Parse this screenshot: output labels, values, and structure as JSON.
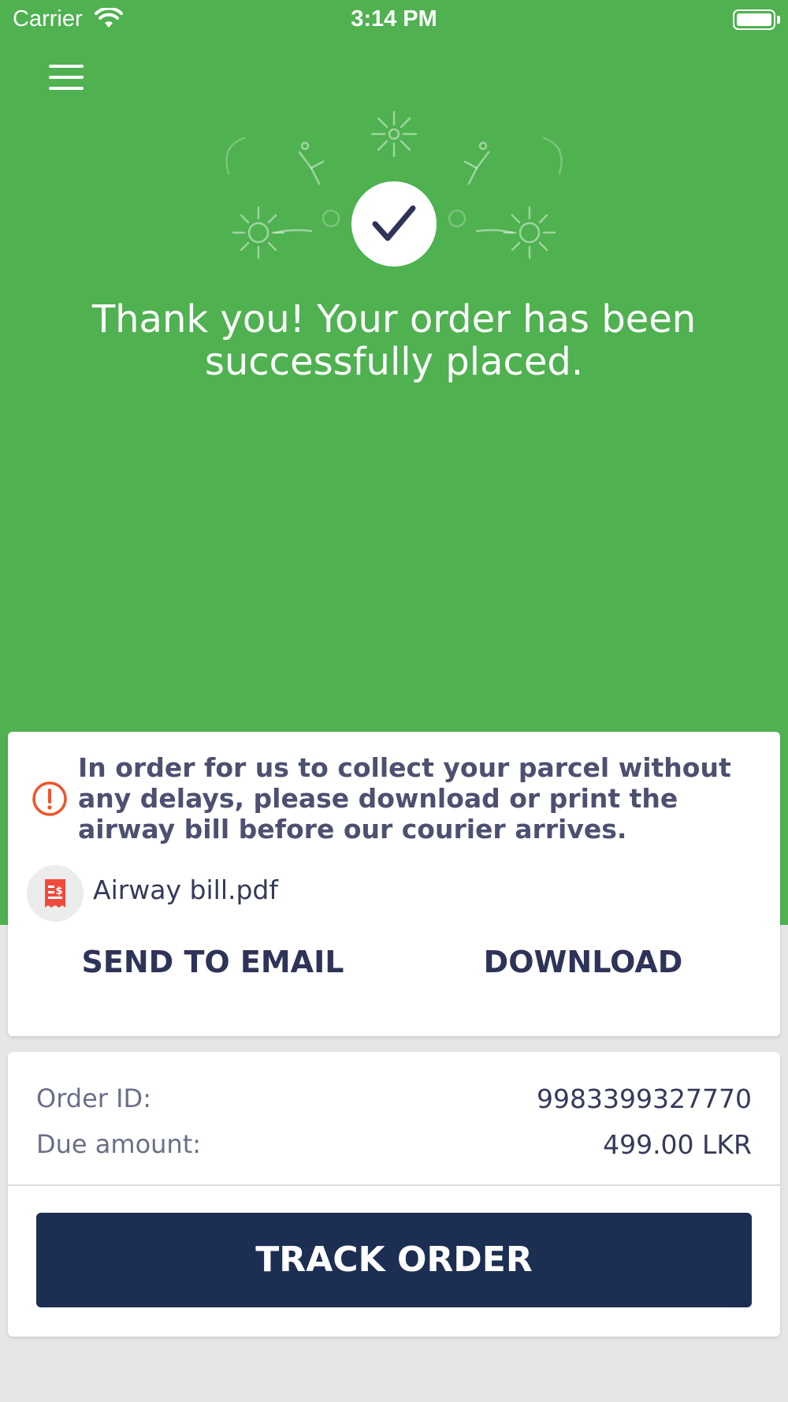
{
  "status_bar": {
    "carrier": "Carrier",
    "time": "3:14 PM",
    "icons": [
      "wifi-icon",
      "battery-icon"
    ]
  },
  "header": {
    "menu_icon": "hamburger-menu-icon"
  },
  "success": {
    "icon": "checkmark-icon",
    "message": "Thank you! Your order has been successfully placed."
  },
  "notice": {
    "icon": "alert-circle-icon",
    "text": "In order for us to collect your parcel without any delays, please download or print the airway bill before our courier arrives.",
    "file_icon": "receipt-icon",
    "file_name": "Airway bill.pdf",
    "send_email_label": "SEND TO EMAIL",
    "download_label": "DOWNLOAD"
  },
  "order": {
    "id_label": "Order ID:",
    "id_value": "9983399327770",
    "due_label": "Due amount:",
    "due_value": "499.00 LKR",
    "track_label": "TRACK ORDER"
  },
  "colors": {
    "header_green": "#4fb150",
    "primary_navy": "#1c2e52",
    "alert_orange": "#f0532a",
    "text_dark": "#353a5a"
  }
}
